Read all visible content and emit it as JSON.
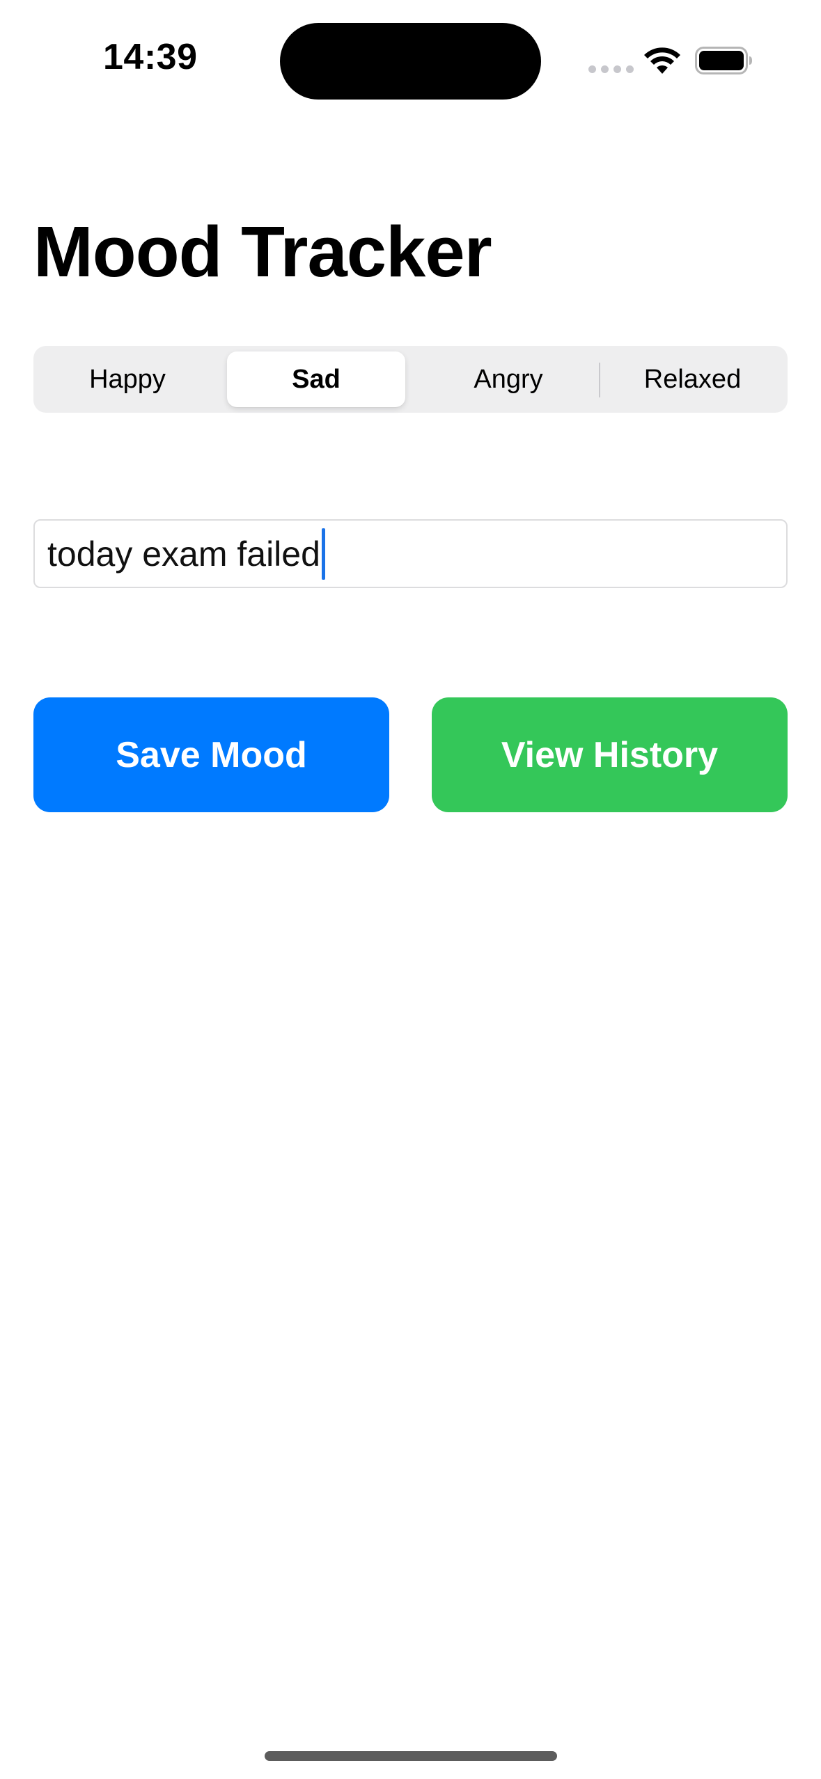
{
  "status_bar": {
    "time": "14:39",
    "icons": [
      "signal-dots-icon",
      "wifi-icon",
      "battery-icon"
    ]
  },
  "page": {
    "title": "Mood Tracker"
  },
  "mood_selector": {
    "options": [
      "Happy",
      "Sad",
      "Angry",
      "Relaxed"
    ],
    "selected": "Sad"
  },
  "note_field": {
    "value": "today exam failed"
  },
  "actions": {
    "save_label": "Save Mood",
    "history_label": "View History"
  },
  "colors": {
    "save_button": "#007aff",
    "history_button": "#34c759",
    "caret": "#1a73e8",
    "segmented_background": "#eeeeef"
  }
}
